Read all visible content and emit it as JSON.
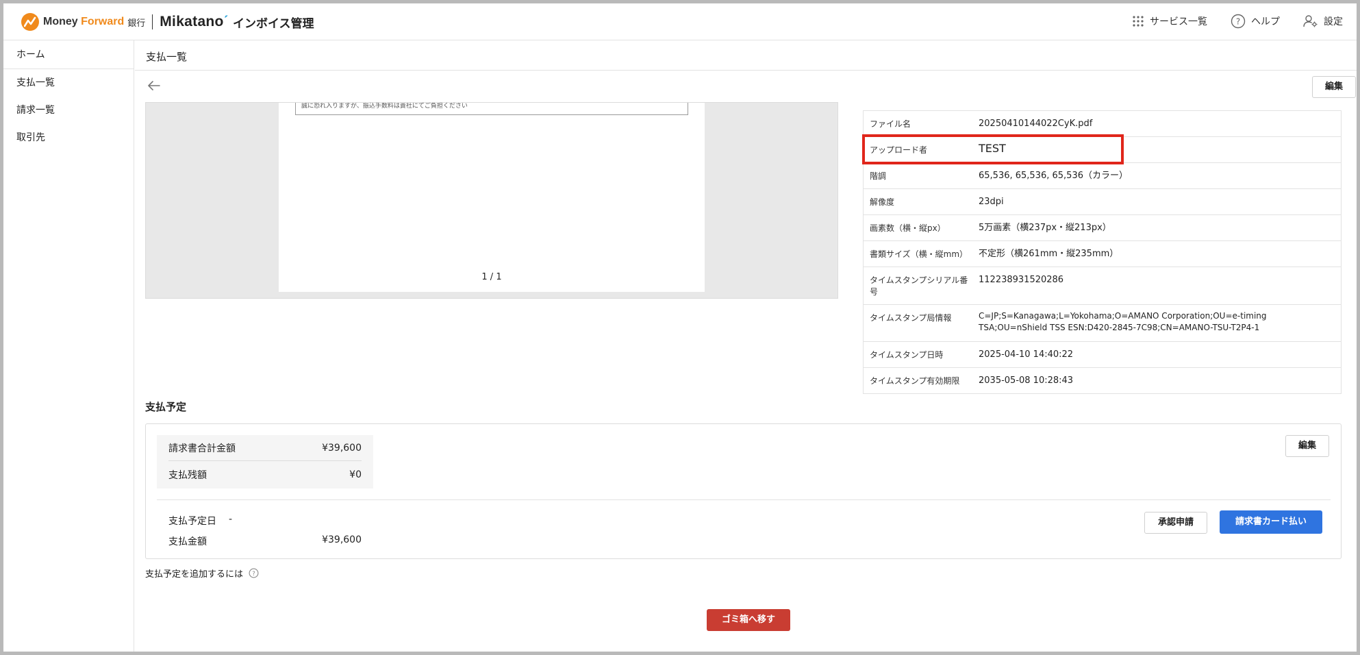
{
  "header": {
    "brand_money": "Money ",
    "brand_forward": "Forward",
    "brand_bank": "銀行",
    "brand_mikatano": "Mikatano",
    "brand_product": "インボイス管理",
    "nav": {
      "services": "サービス一覧",
      "help": "ヘルプ",
      "settings": "設定"
    }
  },
  "sidebar": {
    "items": [
      {
        "label": "ホーム"
      },
      {
        "label": "支払一覧"
      },
      {
        "label": "請求一覧"
      },
      {
        "label": "取引先"
      }
    ]
  },
  "page": {
    "title": "支払一覧",
    "edit_label": "編集"
  },
  "viewer": {
    "doc_snippet": "誠に恐れ入りますが、振込手数料は貴社にてご負担ください",
    "page_indicator": "1 / 1"
  },
  "metadata": [
    {
      "key": "ファイル名",
      "value": "20250410144022CyK.pdf"
    },
    {
      "key": "アップロード者",
      "value": "TEST"
    },
    {
      "key": "階調",
      "value": "65,536, 65,536, 65,536（カラー）"
    },
    {
      "key": "解像度",
      "value": "23dpi"
    },
    {
      "key": "画素数（横・縦px）",
      "value": "5万画素（横237px・縦213px）"
    },
    {
      "key": "書類サイズ（横・縦mm）",
      "value": "不定形（横261mm・縦235mm）"
    },
    {
      "key": "タイムスタンプシリアル番号",
      "value": "112238931520286"
    },
    {
      "key": "タイムスタンプ局情報",
      "value": "C=JP;S=Kanagawa;L=Yokohama;O=AMANO Corporation;OU=e-timing TSA;OU=nShield TSS ESN:D420-2845-7C98;CN=AMANO-TSU-T2P4-1"
    },
    {
      "key": "タイムスタンプ日時",
      "value": "2025-04-10 14:40:22"
    },
    {
      "key": "タイムスタンプ有効期限",
      "value": "2035-05-08 10:28:43"
    }
  ],
  "payment": {
    "section_title": "支払予定",
    "invoice_total_label": "請求書合計金額",
    "invoice_total_value": "¥39,600",
    "balance_label": "支払残額",
    "balance_value": "¥0",
    "edit_label": "編集",
    "due_date_label": "支払予定日",
    "due_date_value": "-",
    "amount_label": "支払金額",
    "amount_value": "¥39,600",
    "approve_label": "承認申請",
    "card_pay_label": "請求書カード払い",
    "add_hint": "支払予定を追加するには"
  },
  "trash_label": "ゴミ箱へ移す",
  "colors": {
    "brand_orange": "#f08a1c",
    "primary_blue": "#2f74e0",
    "danger_red": "#c93d32",
    "highlight_red": "#e0261b"
  }
}
